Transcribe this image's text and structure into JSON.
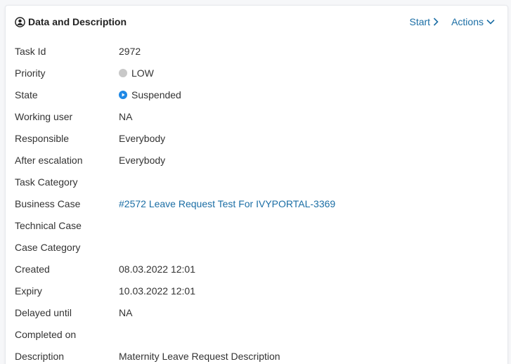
{
  "header": {
    "title": "Data and Description",
    "start_label": "Start",
    "actions_label": "Actions"
  },
  "fields": [
    {
      "label": "Task Id",
      "value": "2972"
    },
    {
      "label": "Priority",
      "value": "LOW",
      "indicator": "priority-low-dot",
      "indicator_color": "#c8c8c8"
    },
    {
      "label": "State",
      "value": "Suspended",
      "indicator": "play-circle-icon",
      "indicator_color": "#1e88e5"
    },
    {
      "label": "Working user",
      "value": "NA"
    },
    {
      "label": "Responsible",
      "value": "Everybody"
    },
    {
      "label": "After escalation",
      "value": "Everybody"
    },
    {
      "label": "Task Category",
      "value": ""
    },
    {
      "label": "Business Case",
      "value": "#2572 Leave Request Test For IVYPORTAL-3369",
      "link": true
    },
    {
      "label": "Technical Case",
      "value": ""
    },
    {
      "label": "Case Category",
      "value": ""
    },
    {
      "label": "Created",
      "value": "08.03.2022 12:01"
    },
    {
      "label": "Expiry",
      "value": "10.03.2022 12:01"
    },
    {
      "label": "Delayed until",
      "value": "NA"
    },
    {
      "label": "Completed on",
      "value": ""
    },
    {
      "label": "Description",
      "value": "Maternity Leave Request Description"
    }
  ],
  "colors": {
    "link": "#1b6ea5",
    "text": "#333333"
  }
}
